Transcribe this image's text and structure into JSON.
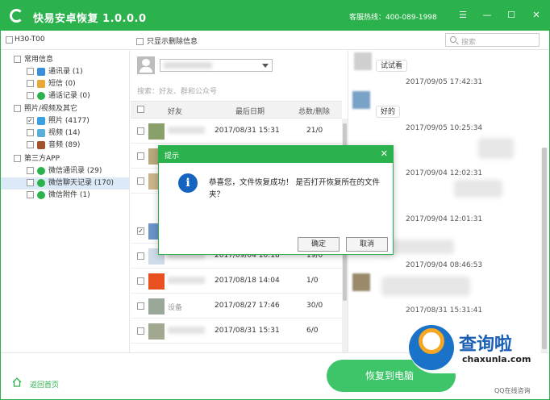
{
  "title_bar": {
    "app_title": "快易安卓恢复  1.0.0.0",
    "hotline": "客服热线：400-089-1998"
  },
  "toolbar": {
    "device": "H30-T00",
    "show_deleted_label": "只显示删除信息",
    "search_placeholder": "搜索"
  },
  "tree": {
    "groups": [
      {
        "label": "常用信息"
      },
      {
        "label": "照片/视频及其它"
      },
      {
        "label": "第三方APP"
      }
    ],
    "items": [
      {
        "label": "通讯录 (1)",
        "color": "#3b8fd9"
      },
      {
        "label": "短信 (0)",
        "color": "#e8a838"
      },
      {
        "label": "通话记录 (0)",
        "color": "#2bb24c"
      },
      {
        "label": "照片 (4177)",
        "color": "#3aa0e0"
      },
      {
        "label": "视频 (14)",
        "color": "#5aaed8"
      },
      {
        "label": "音频 (89)",
        "color": "#a0522d"
      },
      {
        "label": "微信通讯录 (29)",
        "color": "#2bb24c"
      },
      {
        "label": "微信聊天记录 (170)",
        "color": "#2bb24c"
      },
      {
        "label": "微信附件 (1)",
        "color": "#2bb24c"
      }
    ]
  },
  "list": {
    "search_hint": "搜索：好友、群和公众号",
    "headers": {
      "friend": "好友",
      "last_date": "最后日期",
      "total": "总数/删除"
    },
    "rows": [
      {
        "name": "",
        "date": "2017/08/31 15:31",
        "count": "21/0"
      },
      {
        "name": "",
        "date": "",
        "count": ""
      },
      {
        "name": "",
        "date": "",
        "count": ""
      },
      {
        "name": "",
        "date": "",
        "count": ""
      },
      {
        "name": "",
        "date": "2017/09/04 10:18",
        "count": "19/0"
      },
      {
        "name": "",
        "date": "2017/08/18 14:04",
        "count": "1/0"
      },
      {
        "name": "设备",
        "date": "2017/08/27 17:46",
        "count": "30/0"
      },
      {
        "name": "",
        "date": "2017/08/31 15:31",
        "count": "6/0"
      }
    ]
  },
  "chat": {
    "bubbles": [
      "试试看",
      "好的"
    ],
    "timestamps": [
      "2017/09/05 17:42:31",
      "2017/09/05 10:25:34",
      "2017/09/04 12:02:31",
      "2017/09/04 12:01:31",
      "2017/09/04 08:46:53",
      "2017/08/31 15:31:41"
    ]
  },
  "bottom": {
    "home_label": "返回首页",
    "recover_label": "恢复到电脑"
  },
  "dialog": {
    "title": "提示",
    "message": "恭喜您，文件恢复成功！ 是否打开恢复所在的文件夹？",
    "ok": "确定",
    "cancel": "取消"
  },
  "watermark": {
    "brand_cn": "查询啦",
    "brand_en": "chaxunla.com",
    "sub": "QQ在线咨询"
  }
}
